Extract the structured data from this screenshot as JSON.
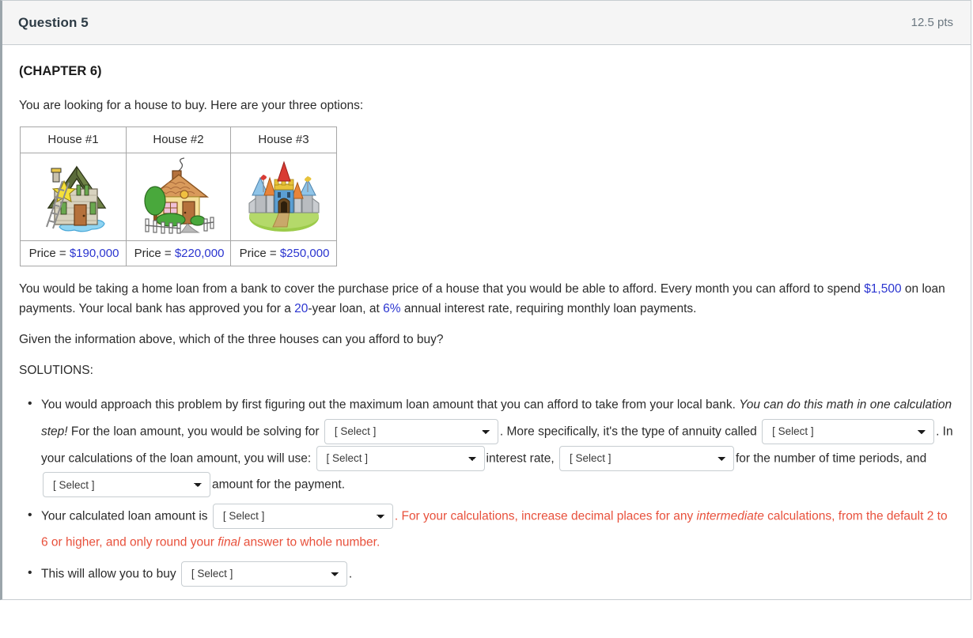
{
  "header": {
    "title": "Question 5",
    "points": "12.5 pts"
  },
  "body": {
    "chapter": "(CHAPTER 6)",
    "intro": "You are looking for a house to buy. Here are your three options:",
    "houses_table": {
      "headers": [
        "House #1",
        "House #2",
        "House #3"
      ],
      "price_label": "Price =",
      "prices": [
        "$190,000",
        "$220,000",
        "$250,000"
      ],
      "images": [
        "fixer-upper-house-image",
        "cottage-house-image",
        "castle-image"
      ]
    },
    "paragraph_loan": {
      "t1": "You would be taking a home loan from a bank to cover the purchase price of a house that you would be able to afford. Every month you can afford to spend ",
      "monthly_payment": "$1,500",
      "t2": " on loan payments. Your local bank has approved you for a ",
      "years": "20",
      "t3": "-year loan, at ",
      "rate": "6%",
      "t4": " annual interest rate, requiring monthly loan payments."
    },
    "question": "Given the information above, which of the three houses can you afford to buy?",
    "solutions_label": "SOLUTIONS:",
    "bullets": {
      "b1": {
        "t1": "You would approach this problem by first figuring out the maximum loan amount that you can afford to take from your local bank. ",
        "em1": "You can do this math in one calculation step!",
        "t2": " For the loan amount, you would be solving for",
        "select1": "[ Select ]",
        "t3": ". More specifically, it's the type of annuity called",
        "select2": "[ Select ]",
        "t4": ". In your calculations of the loan amount, you will use:",
        "select3": "[ Select ]",
        "t5": "interest rate,",
        "select4": "[ Select ]",
        "t6": "for the number of time periods, and",
        "select5": "[ Select ]",
        "t7": "amount for the payment."
      },
      "b2": {
        "t1": "Your calculated loan amount is",
        "select1": "[ Select ]",
        "t2": ". For your calculations, increase decimal places for any ",
        "em1": "intermediate",
        "t3": " calculations, from the default 2 to 6 or higher, and only round your ",
        "em2": "final",
        "t4": " answer to whole number."
      },
      "b3": {
        "t1": "This will allow you to buy",
        "select1": "[ Select ]",
        "t2": "."
      }
    }
  },
  "colors": {
    "blue_value": "#2b35d0",
    "red_note": "#e8513c",
    "header_bg": "#f5f5f5",
    "border": "#c7cdd1"
  }
}
